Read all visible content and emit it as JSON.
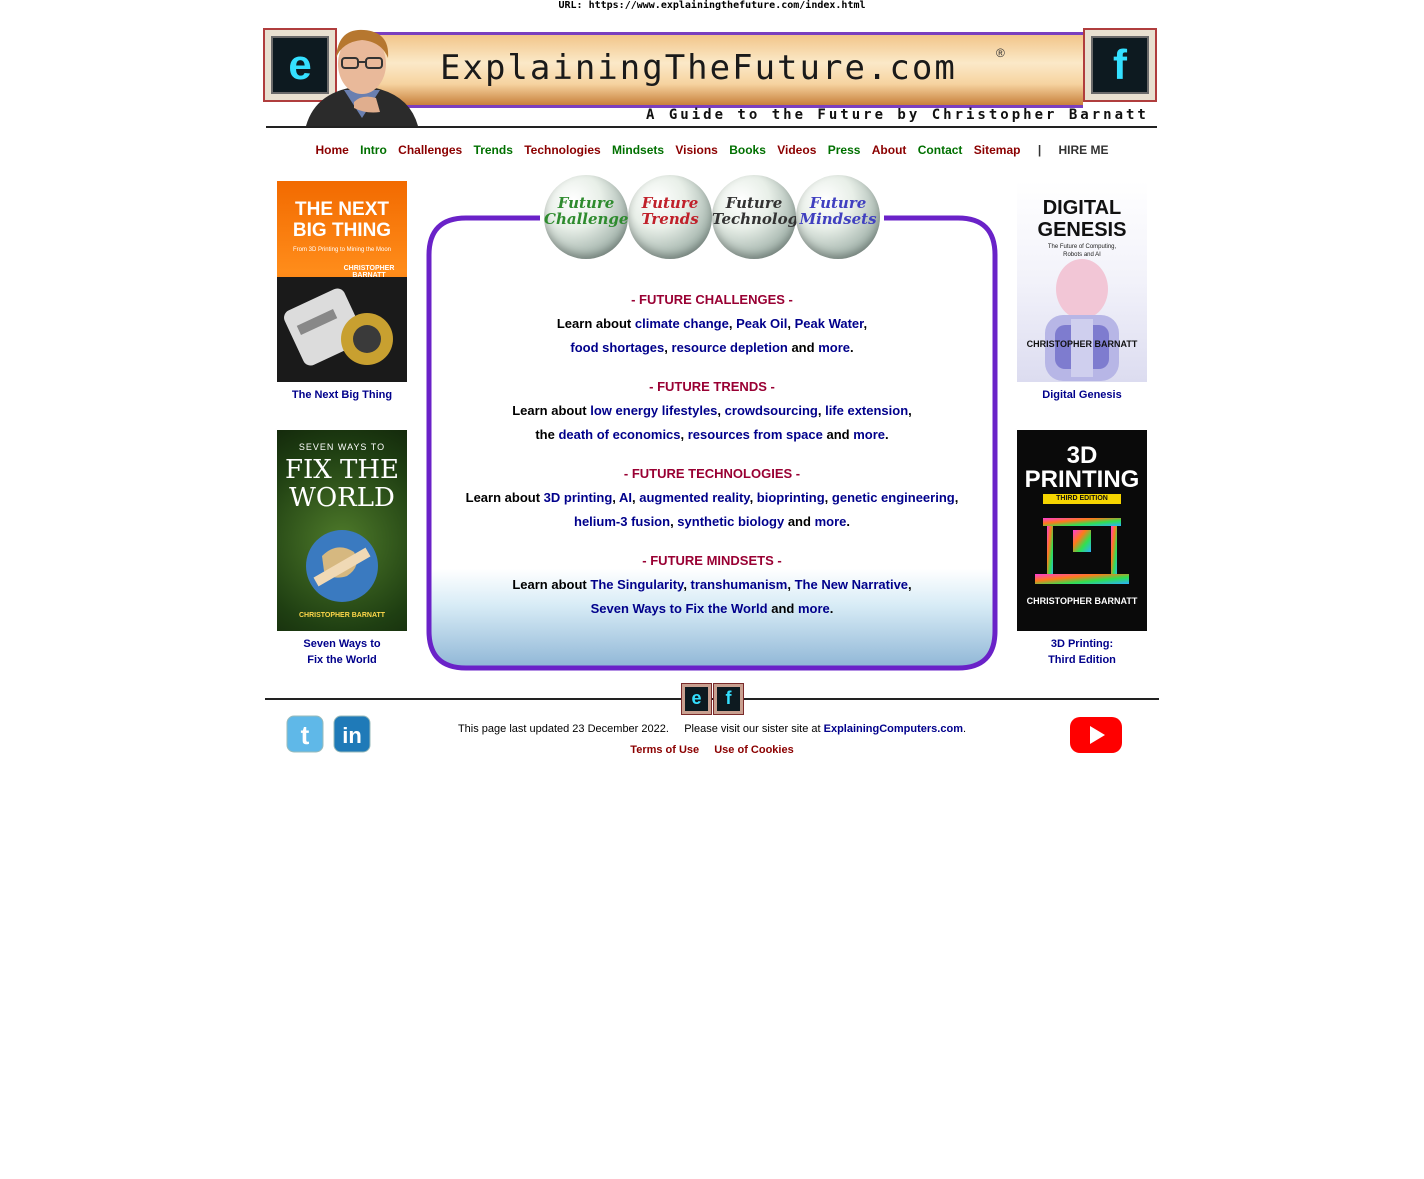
{
  "url_bar": "URL: https://www.explainingthefuture.com/index.html",
  "banner": {
    "title": "ExplainingTheFuture.com",
    "registered": "®",
    "subtitle": "A Guide to the Future by Christopher Barnatt",
    "left_logo": "e",
    "right_logo": "f"
  },
  "nav": {
    "items": [
      {
        "label": "Home",
        "color": "#8b0000"
      },
      {
        "label": "Intro",
        "color": "#007000"
      },
      {
        "label": "Challenges",
        "color": "#8b0000"
      },
      {
        "label": "Trends",
        "color": "#007000"
      },
      {
        "label": "Technologies",
        "color": "#8b0000"
      },
      {
        "label": "Mindsets",
        "color": "#007000"
      },
      {
        "label": "Visions",
        "color": "#8b0000"
      },
      {
        "label": "Books",
        "color": "#007000"
      },
      {
        "label": "Videos",
        "color": "#8b0000"
      },
      {
        "label": "Press",
        "color": "#007000"
      },
      {
        "label": "About",
        "color": "#8b0000"
      },
      {
        "label": "Contact",
        "color": "#007000"
      },
      {
        "label": "Sitemap",
        "color": "#8b0000"
      }
    ],
    "separator": "|",
    "hire": "HIRE ME"
  },
  "books_left": [
    {
      "title": "The Next Big Thing",
      "cover_l1": "THE NEXT",
      "cover_l2": "BIG THING",
      "cover_sub": "From 3D Printing to Mining the Moon",
      "cover_author": "CHRISTOPHER BARNATT"
    },
    {
      "title_l1": "Seven Ways to",
      "title_l2": "Fix the World",
      "cover_l0": "SEVEN WAYS TO",
      "cover_l1": "FIX THE",
      "cover_l2": "WORLD",
      "cover_author": "CHRISTOPHER BARNATT"
    }
  ],
  "books_right": [
    {
      "title": "Digital Genesis",
      "cover_l1": "DIGITAL",
      "cover_l2": "GENESIS",
      "cover_sub": "The Future of Computing, Robots and AI",
      "cover_author": "CHRISTOPHER BARNATT"
    },
    {
      "title_l1": "3D Printing:",
      "title_l2": "Third Edition",
      "cover_l1": "3D",
      "cover_l2": "PRINTING",
      "cover_sub": "THIRD EDITION",
      "cover_author": "CHRISTOPHER BARNATT"
    }
  ],
  "bubbles": [
    {
      "l1": "Future",
      "l2": "Challenges",
      "color": "#2e8b2e"
    },
    {
      "l1": "Future",
      "l2": "Trends",
      "color": "#c0202a"
    },
    {
      "l1": "Future",
      "l2": "Technologies",
      "color": "#333333"
    },
    {
      "l1": "Future",
      "l2": "Mindsets",
      "color": "#4040c0"
    }
  ],
  "sections": {
    "challenges": {
      "heading": "- FUTURE CHALLENGES -",
      "learn": "Learn about",
      "l1": "climate change",
      "l2": "Peak Oil",
      "l3": "Peak Water",
      "l4": "food shortages",
      "l5": "resource depletion",
      "and": "and",
      "more": "more"
    },
    "trends": {
      "heading": "- FUTURE TRENDS -",
      "learn": "Learn about",
      "l1": "low energy lifestyles",
      "l2": "crowdsourcing",
      "l3": "life extension",
      "the": "the",
      "l4": "death of economics",
      "l5": "resources from space",
      "and": "and",
      "more": "more"
    },
    "technologies": {
      "heading": "- FUTURE TECHNOLOGIES -",
      "learn": "Learn about",
      "l1": "3D printing",
      "l2": "AI",
      "l3": "augmented reality",
      "l4": "bioprinting",
      "l5": "genetic engineering",
      "l6": "helium-3 fusion",
      "l7": "synthetic biology",
      "and": "and",
      "more": "more"
    },
    "mindsets": {
      "heading": "- FUTURE MINDSETS -",
      "learn": "Learn about",
      "l1": "The Singularity",
      "l2": "transhumanism",
      "l3": "The New Narrative",
      "l4": "Seven Ways to Fix the World",
      "and": "and",
      "more": "more"
    }
  },
  "footer": {
    "updated": "This page last updated 23 December 2022.",
    "sister_pre": "Please visit our sister site at",
    "sister_link": "ExplainingComputers.com",
    "terms": "Terms of Use",
    "cookies": "Use of Cookies",
    "logo_e": "e",
    "logo_f": "f"
  }
}
